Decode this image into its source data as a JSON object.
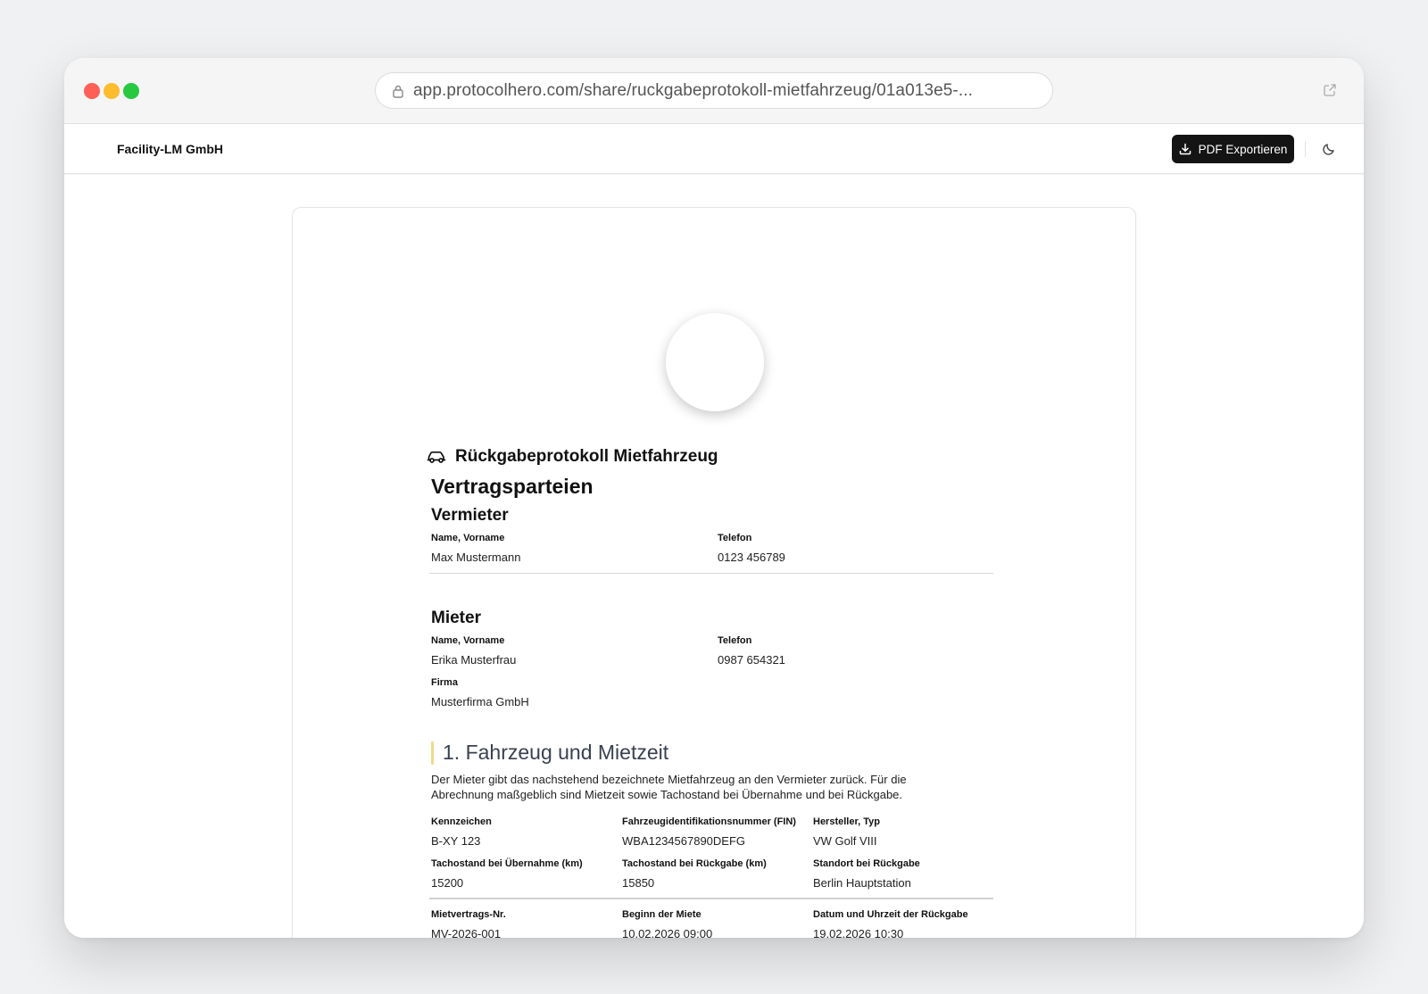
{
  "browser": {
    "url": "app.protocolhero.com/share/ruckgabeprotokoll-mietfahrzeug/01a013e5-..."
  },
  "appbar": {
    "company": "Facility-LM GmbH",
    "pdf_button": "PDF Exportieren"
  },
  "document": {
    "title": "Rückgabeprotokoll Mietfahrzeug",
    "parties_heading": "Vertragsparteien",
    "landlord": {
      "heading": "Vermieter",
      "name_label": "Name, Vorname",
      "name_value": "Max Mustermann",
      "phone_label": "Telefon",
      "phone_value": "0123 456789"
    },
    "tenant": {
      "heading": "Mieter",
      "name_label": "Name, Vorname",
      "name_value": "Erika Musterfrau",
      "phone_label": "Telefon",
      "phone_value": "0987 654321",
      "company_label": "Firma",
      "company_value": "Musterfirma GmbH"
    },
    "section1": {
      "title": "1. Fahrzeug und Mietzeit",
      "intro_line1": "Der Mieter gibt das nachstehend bezeichnete Mietfahrzeug an den Vermieter zurück. Für die",
      "intro_line2": "Abrechnung maßgeblich sind Mietzeit sowie Tachostand bei Übernahme und bei Rückgabe.",
      "fields": [
        {
          "label": "Kennzeichen",
          "value": "B-XY 123"
        },
        {
          "label": "Fahrzeugidentifikationsnummer (FIN)",
          "value": "WBA1234567890DEFG"
        },
        {
          "label": "Hersteller, Typ",
          "value": "VW Golf VIII"
        },
        {
          "label": "Tachostand bei Übernahme (km)",
          "value": "15200"
        },
        {
          "label": "Tachostand bei Rückgabe (km)",
          "value": "15850"
        },
        {
          "label": "Standort bei Rückgabe",
          "value": "Berlin Hauptstation"
        },
        {
          "label": "Mietvertrags-Nr.",
          "value": "MV-2026-001"
        },
        {
          "label": "Beginn der Miete",
          "value": "10.02.2026 09:00"
        },
        {
          "label": "Datum und Uhrzeit der Rückgabe",
          "value": "19.02.2026 10:30"
        }
      ]
    }
  }
}
